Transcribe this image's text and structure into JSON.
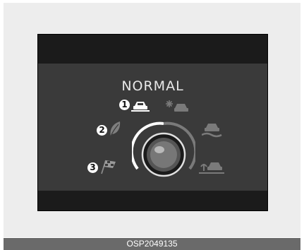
{
  "display": {
    "mode_title": "NORMAL",
    "markers": [
      {
        "number": "1",
        "mode_icon": "normal-car-icon"
      },
      {
        "number": "2",
        "mode_icon": "eco-leaf-icon"
      },
      {
        "number": "3",
        "mode_icon": "sport-checkered-flag-icon"
      }
    ],
    "dimmed_icons": [
      "snow-mode-icon",
      "mud-mode-icon",
      "sand-mode-icon"
    ],
    "knob_icon": "drive-mode-knob-icon"
  },
  "caption": {
    "code": "OSP2049135"
  },
  "colors": {
    "display_bg": "#3a3a3a",
    "display_band": "#1b1b1b",
    "active_white": "#ffffff",
    "dimmed_gray": "#777777",
    "caption_bar": "#6a6a6a"
  }
}
